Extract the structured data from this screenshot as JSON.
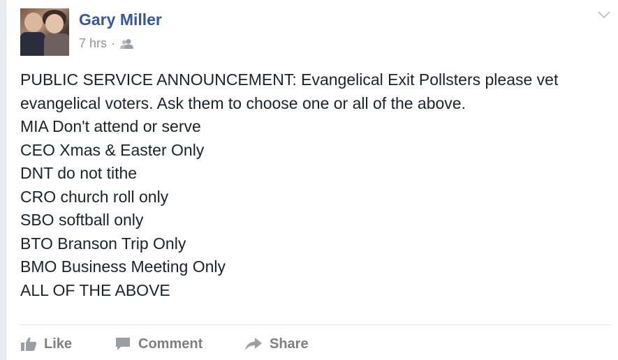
{
  "post": {
    "author": "Gary Miller",
    "time": "7 hrs",
    "separator": "·",
    "audience_icon": "friends-icon",
    "options_icon": "chevron-down-icon",
    "text_lines": [
      "PUBLIC SERVICE ANNOUNCEMENT: Evangelical Exit Pollsters please vet",
      "evangelical voters. Ask them to choose one or all of the above.",
      "MIA Don't attend or serve",
      "CEO Xmas & Easter Only",
      "DNT do not tithe",
      "CRO church roll only",
      "SBO softball only",
      "BTO Branson Trip Only",
      "BMO Business Meeting Only",
      "ALL OF THE ABOVE"
    ]
  },
  "actions": {
    "like_label": "Like",
    "comment_label": "Comment",
    "share_label": "Share",
    "like_icon": "thumbs-up-icon",
    "comment_icon": "speech-bubble-icon",
    "share_icon": "share-arrow-icon"
  },
  "colors": {
    "author_link": "#365899",
    "meta_text": "#90949c",
    "body_text": "#1d2129",
    "action_text": "#7f7f7f"
  }
}
